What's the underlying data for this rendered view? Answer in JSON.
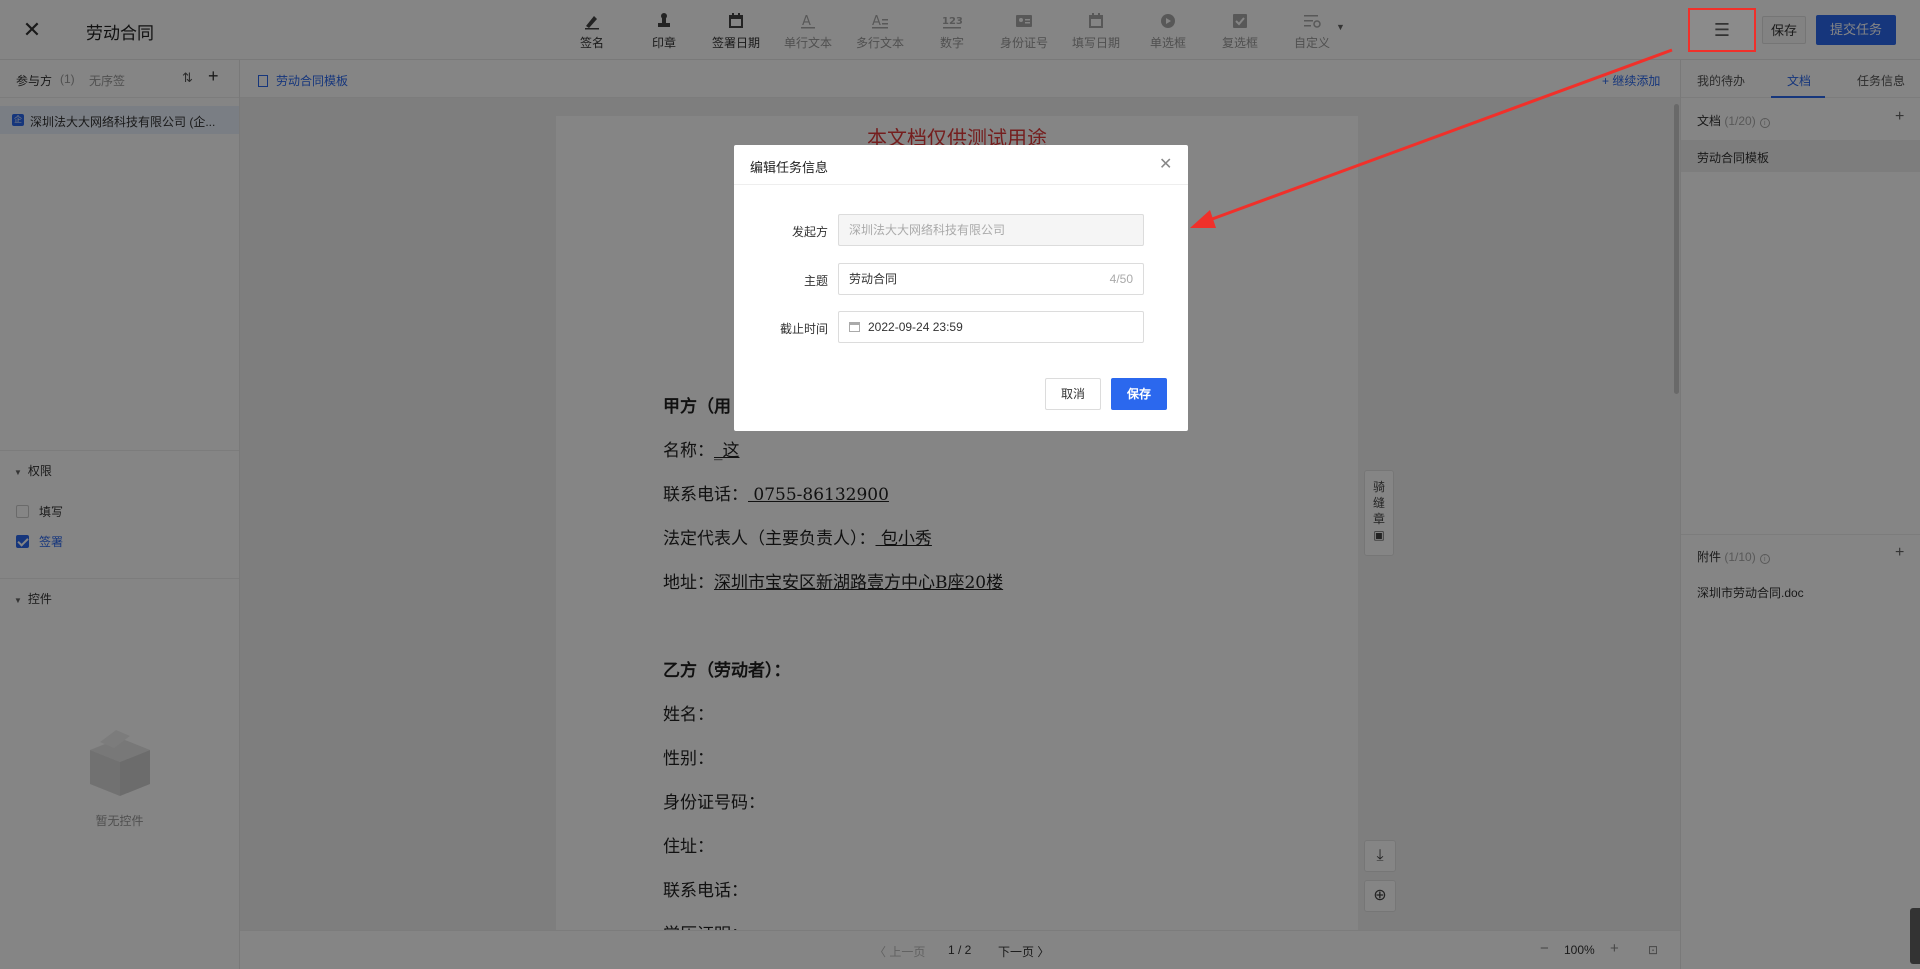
{
  "header": {
    "title": "劳动合同",
    "tools": [
      {
        "label": "签名",
        "icon": "signature-icon",
        "enabled": true
      },
      {
        "label": "印章",
        "icon": "stamp-icon",
        "enabled": true
      },
      {
        "label": "签署日期",
        "icon": "calendar-icon",
        "enabled": true
      },
      {
        "label": "单行文本",
        "icon": "single-line-text-icon",
        "enabled": false
      },
      {
        "label": "多行文本",
        "icon": "multi-line-text-icon",
        "enabled": false
      },
      {
        "label": "数字",
        "icon": "number-123-icon",
        "enabled": false
      },
      {
        "label": "身份证号",
        "icon": "id-card-icon",
        "enabled": false
      },
      {
        "label": "填写日期",
        "icon": "calendar-fill-icon",
        "enabled": false
      },
      {
        "label": "单选框",
        "icon": "radio-icon",
        "enabled": false
      },
      {
        "label": "复选框",
        "icon": "checkbox-icon",
        "enabled": false
      },
      {
        "label": "自定义",
        "icon": "custom-settings-icon",
        "enabled": false
      }
    ],
    "menu_icon": "☰",
    "save_label": "保存",
    "submit_label": "提交任务"
  },
  "left": {
    "participants_label": "参与方",
    "participants_count": "(1)",
    "unordered_label": "无序签",
    "party_badge": "企",
    "party_name": "深圳法大大网络科技有限公司 (企...",
    "permissions_title": "权限",
    "permissions": [
      {
        "label": "填写",
        "checked": false
      },
      {
        "label": "签署",
        "checked": true
      }
    ],
    "controls_title": "控件",
    "empty_text": "暂无控件"
  },
  "center": {
    "template_link": "劳动合同模板",
    "continue_add": "+ 继续添加",
    "watermark": "本文档仅供测试用途",
    "lines": [
      {
        "text": "甲方（用",
        "bold": true
      },
      {
        "text": "名称：",
        "u": "_这",
        "bold": false
      },
      {
        "text": "联系电话：",
        "u": "  0755-86132900  ",
        "bold": false
      },
      {
        "text": "法定代表人（主要负责人）：",
        "u": "  包小秀  ",
        "bold": false
      },
      {
        "text": "地址：",
        "u": "深圳市宝安区新湖路壹方中心B座20楼",
        "bold": false
      },
      {
        "text": "乙方（劳动者）：",
        "bold": true
      },
      {
        "text": "姓名：",
        "bold": false
      },
      {
        "text": "性别：",
        "bold": false
      },
      {
        "text": "身份证号码：",
        "bold": false
      },
      {
        "text": "住址：",
        "bold": false
      },
      {
        "text": "联系电话：",
        "bold": false
      },
      {
        "text": "学历证明：",
        "bold": false
      }
    ],
    "seam_label": [
      "骑",
      "缝",
      "章"
    ],
    "pager": {
      "prev": "〈 上一页",
      "page": "1 / 2",
      "next": "下一页 〉",
      "minus": "−",
      "zoom": "100%",
      "plus": "+"
    }
  },
  "right": {
    "tabs": [
      "我的待办",
      "文档",
      "任务信息"
    ],
    "active_tab": "文档",
    "docs_title": "文档",
    "docs_count": "(1/20)",
    "doc_item": "劳动合同模板",
    "attach_title": "附件",
    "attach_count": "(1/10)",
    "attach_item": "深圳市劳动合同.doc"
  },
  "modal": {
    "title": "编辑任务信息",
    "initiator_label": "发起方",
    "initiator_value": "深圳法大大网络科技有限公司",
    "subject_label": "主题",
    "subject_value": "劳动合同",
    "subject_counter": "4/50",
    "deadline_label": "截止时间",
    "deadline_value": "2022-09-24 23:59",
    "cancel_label": "取消",
    "save_label": "保存"
  },
  "colors": {
    "primary": "#2b68ee",
    "annotation_red": "#f0302a",
    "watermark_red": "#e03a3a"
  }
}
